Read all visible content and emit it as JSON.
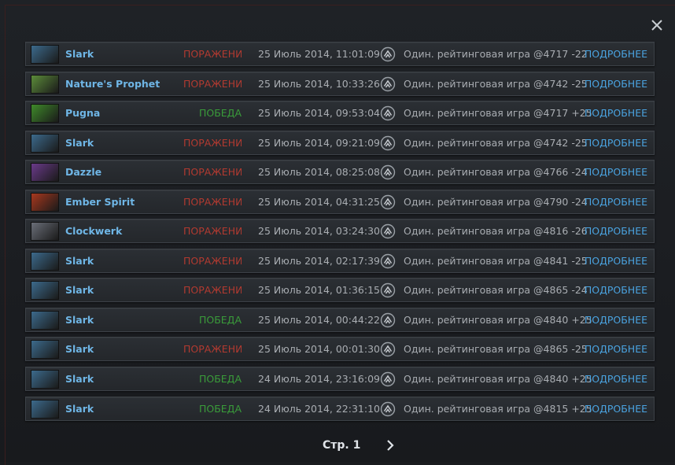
{
  "dialog": {
    "close_icon": "close-icon"
  },
  "columns_icons": {
    "mode_icon": "ranked-badge-icon"
  },
  "details_label": "ПОДРОБНЕЕ",
  "matches": [
    {
      "hero": "Slark",
      "result": "ПОРАЖЕНИЕ",
      "outcome": "loss",
      "date": "25 Июль 2014, 11:01:09",
      "mode": "Один. рейтинговая игра @4717 -22",
      "portrait_color": "#3c6a8c"
    },
    {
      "hero": "Nature's Prophet",
      "result": "ПОРАЖЕНИЕ",
      "outcome": "loss",
      "date": "25 Июль 2014, 10:33:26",
      "mode": "Один. рейтинговая игра @4742 -25",
      "portrait_color": "#5c8c3a"
    },
    {
      "hero": "Pugna",
      "result": "ПОБЕДА",
      "outcome": "win",
      "date": "25 Июль 2014, 09:53:04",
      "mode": "Один. рейтинговая игра @4717 +25",
      "portrait_color": "#3f8a2a"
    },
    {
      "hero": "Slark",
      "result": "ПОРАЖЕНИЕ",
      "outcome": "loss",
      "date": "25 Июль 2014, 09:21:09",
      "mode": "Один. рейтинговая игра @4742 -25",
      "portrait_color": "#3c6a8c"
    },
    {
      "hero": "Dazzle",
      "result": "ПОРАЖЕНИЕ",
      "outcome": "loss",
      "date": "25 Июль 2014, 08:25:08",
      "mode": "Один. рейтинговая игра @4766 -24",
      "portrait_color": "#6a3a8a"
    },
    {
      "hero": "Ember Spirit",
      "result": "ПОРАЖЕНИЕ",
      "outcome": "loss",
      "date": "25 Июль 2014, 04:31:25",
      "mode": "Один. рейтинговая игра @4790 -24",
      "portrait_color": "#a8381e"
    },
    {
      "hero": "Clockwerk",
      "result": "ПОРАЖЕНИЕ",
      "outcome": "loss",
      "date": "25 Июль 2014, 03:24:30",
      "mode": "Один. рейтинговая игра @4816 -26",
      "portrait_color": "#6a6e78"
    },
    {
      "hero": "Slark",
      "result": "ПОРАЖЕНИЕ",
      "outcome": "loss",
      "date": "25 Июль 2014, 02:17:39",
      "mode": "Один. рейтинговая игра @4841 -25",
      "portrait_color": "#3c6a8c"
    },
    {
      "hero": "Slark",
      "result": "ПОРАЖЕНИЕ",
      "outcome": "loss",
      "date": "25 Июль 2014, 01:36:15",
      "mode": "Один. рейтинговая игра @4865 -24",
      "portrait_color": "#3c6a8c"
    },
    {
      "hero": "Slark",
      "result": "ПОБЕДА",
      "outcome": "win",
      "date": "25 Июль 2014, 00:44:22",
      "mode": "Один. рейтинговая игра @4840 +25",
      "portrait_color": "#3c6a8c"
    },
    {
      "hero": "Slark",
      "result": "ПОРАЖЕНИЕ",
      "outcome": "loss",
      "date": "25 Июль 2014, 00:01:30",
      "mode": "Один. рейтинговая игра @4865 -25",
      "portrait_color": "#3c6a8c"
    },
    {
      "hero": "Slark",
      "result": "ПОБЕДА",
      "outcome": "win",
      "date": "24 Июль 2014, 23:16:09",
      "mode": "Один. рейтинговая игра @4840 +25",
      "portrait_color": "#3c6a8c"
    },
    {
      "hero": "Slark",
      "result": "ПОБЕДА",
      "outcome": "win",
      "date": "24 Июль 2014, 22:31:10",
      "mode": "Один. рейтинговая игра @4815 +25",
      "portrait_color": "#3c6a8c"
    }
  ],
  "pager": {
    "label": "Стр. 1",
    "next_icon": "chevron-right-icon"
  }
}
